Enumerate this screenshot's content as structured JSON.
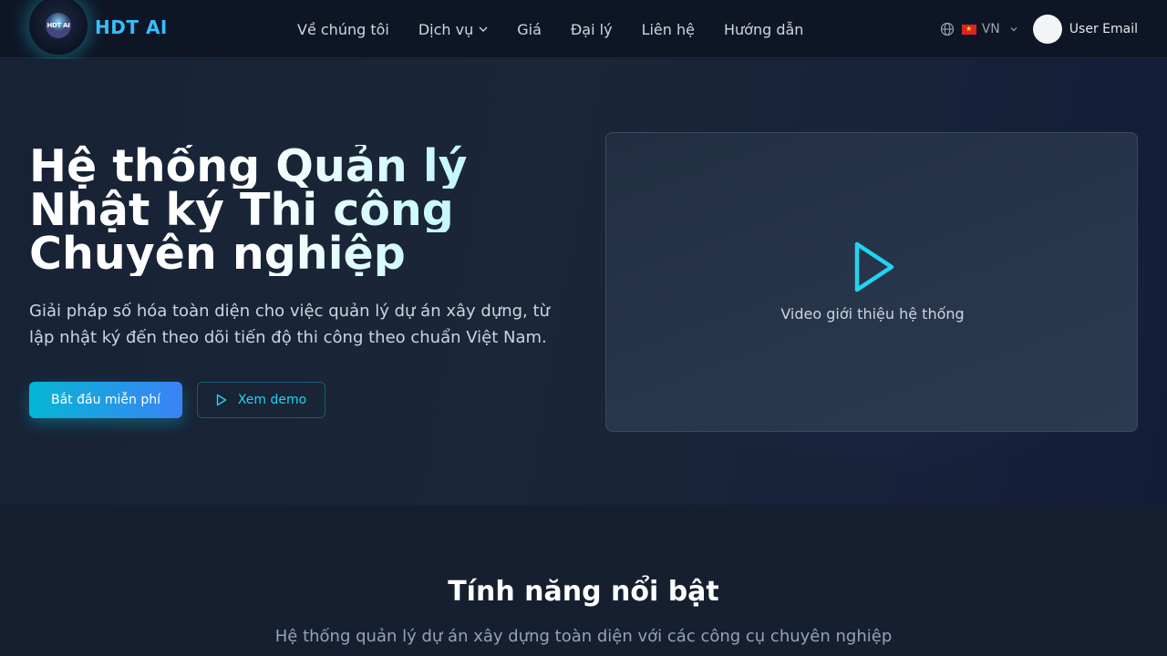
{
  "brand": {
    "logo_text": "HDT AI",
    "name": "HDT AI"
  },
  "nav": {
    "items": [
      {
        "label": "Về chúng tôi"
      },
      {
        "label": "Dịch vụ"
      },
      {
        "label": "Giá"
      },
      {
        "label": "Đại lý"
      },
      {
        "label": "Liên hệ"
      },
      {
        "label": "Hướng dẫn"
      }
    ],
    "language": "VN",
    "user_email": "User Email"
  },
  "hero": {
    "title_line1": "Hệ thống Quản lý",
    "title_line2": "Nhật ký Thi công",
    "title_line3": "Chuyên nghiệp",
    "subtitle": "Giải pháp số hóa toàn diện cho việc quản lý dự án xây dựng, từ lập nhật ký đến theo dõi tiến độ thi công theo chuẩn Việt Nam.",
    "primary_button": "Bắt đầu miễn phí",
    "demo_button": "Xem demo",
    "video_label": "Video giới thiệu hệ thống"
  },
  "features": {
    "title": "Tính năng nổi bật",
    "subtitle": "Hệ thống quản lý dự án xây dựng toàn diện với các công cụ chuyên nghiệp"
  },
  "colors": {
    "accent": "#22d3ee",
    "brand": "#38bdf8",
    "nav_bg": "#0e1626",
    "hero_bg": "#1b2638"
  },
  "icons": {
    "language": "globe-icon",
    "flag": "vn-flag-icon",
    "dropdown": "chevron-down-icon",
    "play": "play-icon"
  }
}
